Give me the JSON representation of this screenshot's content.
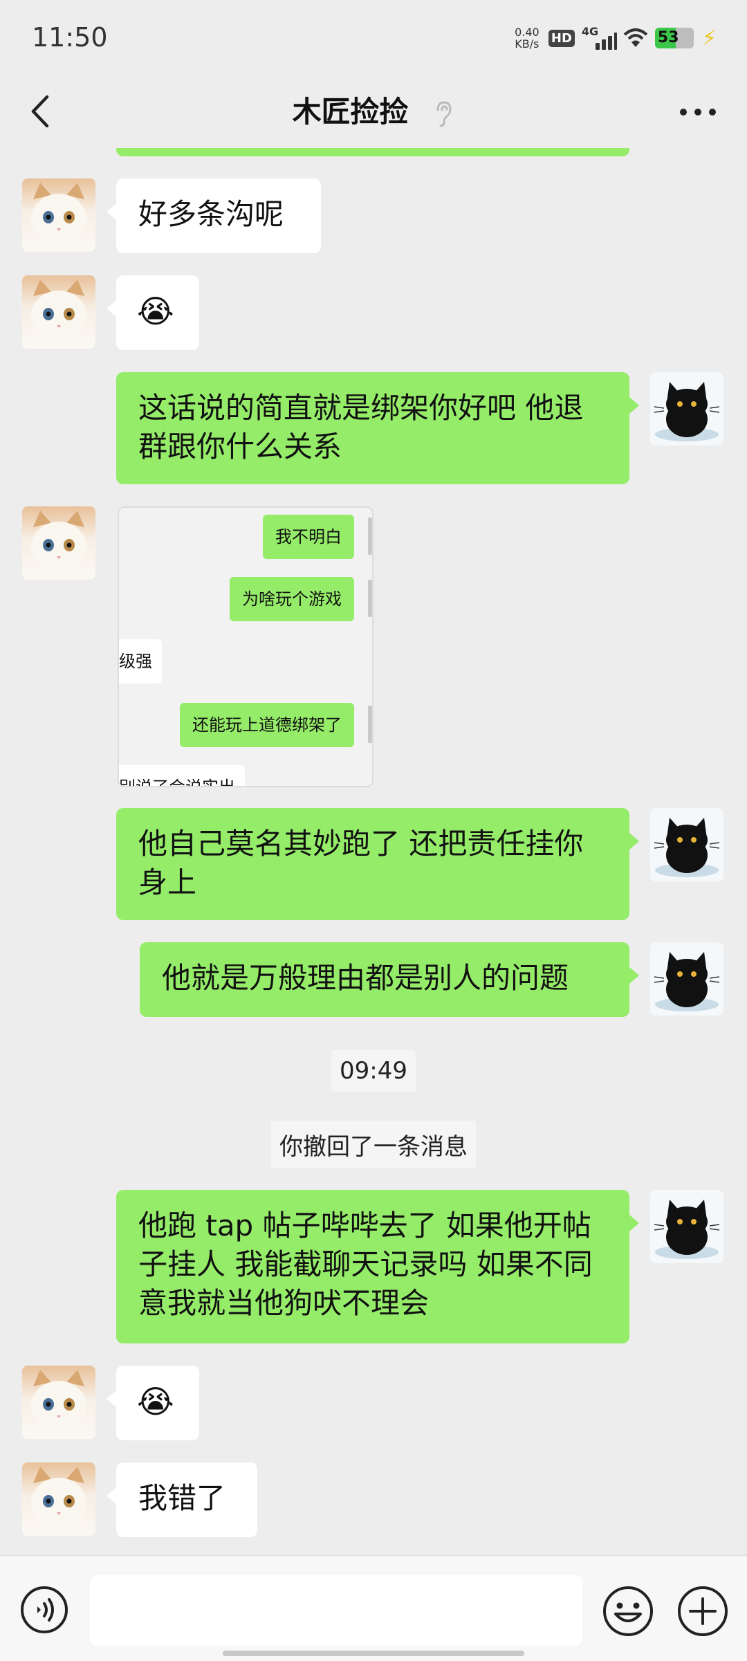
{
  "status_bar": {
    "time": "11:50",
    "net_speed_value": "0.40",
    "net_speed_unit": "KB/s",
    "hd": "HD",
    "network": "4G",
    "battery": "53",
    "battery_level_percent": 53
  },
  "header": {
    "title": "木匠捡捡"
  },
  "messages": [
    {
      "side": "left",
      "text": "好多条沟呢"
    },
    {
      "side": "left",
      "text": "😭"
    },
    {
      "side": "right",
      "text": "这话说的简直就是绑架你好吧 他退群跟你什么关系"
    },
    {
      "side": "left",
      "type": "image"
    },
    {
      "side": "right",
      "text": "他自己莫名其妙跑了 还把责任挂你身上"
    },
    {
      "side": "right",
      "text": "他就是万般理由都是别人的问题"
    },
    {
      "side": "right",
      "text": "他跑 tap 帖子哔哔去了 如果他开帖子挂人 我能截聊天记录吗 如果不同意我就当他狗吠不理会"
    },
    {
      "side": "left",
      "text": "😭"
    },
    {
      "side": "left",
      "text": "我错了"
    }
  ],
  "system": {
    "timestamp": "09:49",
    "recalled": "你撤回了一条消息"
  },
  "screenshot": {
    "line1": "我不明白",
    "line2": "为啥玩个游戏",
    "line3": "级强",
    "line4": "还能玩上道德绑架了",
    "line5": "别说了会说实出"
  },
  "colors": {
    "background": "#ededed",
    "outgoing_bubble": "#95ec69",
    "incoming_bubble": "#ffffff"
  },
  "icons": [
    "back-arrow-icon",
    "mute-ear-icon",
    "more-icon",
    "voice-icon",
    "emoji-icon",
    "plus-icon"
  ]
}
